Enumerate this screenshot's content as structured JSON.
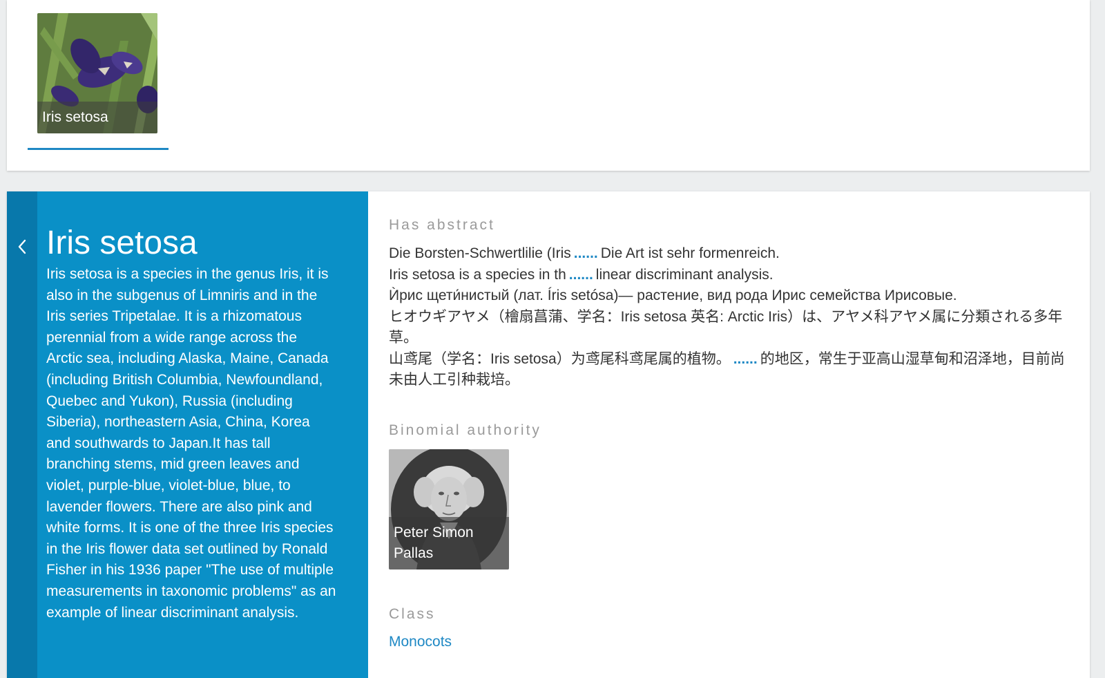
{
  "top": {
    "tile_caption": "Iris setosa"
  },
  "side": {
    "title": "Iris setosa",
    "abstract": "Iris setosa is a species in the genus Iris, it is also in the subgenus of Limniris and in the Iris series Tripetalae. It is a rhizomatous perennial from a wide range across the Arctic sea, including Alaska, Maine, Canada (including British Columbia, Newfoundland, Quebec and Yukon), Russia (including Siberia), northeastern Asia, China, Korea and southwards to Japan.It has tall branching stems, mid green leaves and violet, purple-blue, violet-blue, blue, to lavender flowers. There are also pink and white forms. It is one of the three Iris species in the Iris flower data set outlined by Ronald Fisher in his 1936 paper \"The use of multiple measurements in taxonomic problems\" as an example of linear discriminant analysis."
  },
  "has_abstract": {
    "label": "Has abstract",
    "more": "......",
    "items": [
      {
        "start": "Die Borsten-Schwertlilie (Iris",
        "end": "Die Art ist sehr formenreich."
      },
      {
        "start": "Iris setosa is a species in th",
        "end": "linear discriminant analysis."
      },
      {
        "start": "Ѝрис щети́нистый (лат. Íris setósa)— растение, вид рода Ирис семейства Ирисовые.",
        "end": ""
      },
      {
        "start": "ヒオウギアヤメ（檜扇菖蒲、学名：Iris setosa 英名: Arctic Iris）は、アヤメ科アヤメ属に分類される多年草。",
        "end": ""
      },
      {
        "start": "山鸢尾（学名：Iris setosa）为鸢尾科鸢尾属的植物。",
        "end": "的地区，常生于亚高山湿草甸和沼泽地，目前尚未由人工引种栽培。"
      }
    ]
  },
  "binomial_authority": {
    "label": "Binomial authority",
    "name": "Peter Simon Pallas"
  },
  "class_section": {
    "label": "Class",
    "value": "Monocots"
  },
  "colors": {
    "accent": "#1e88c4",
    "side_panel": "#0a90c7",
    "back_strip": "#0878ab"
  }
}
